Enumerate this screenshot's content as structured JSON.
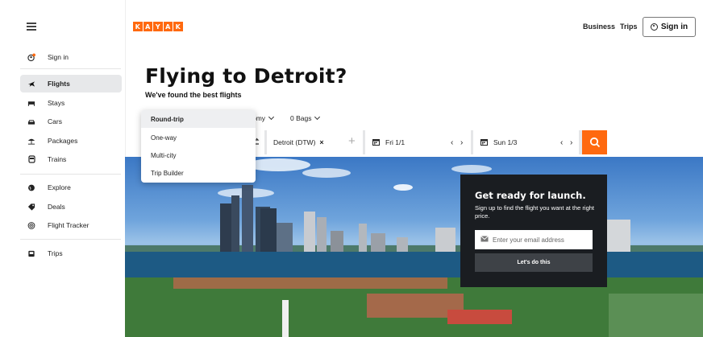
{
  "brand": {
    "logo_letters": [
      "K",
      "A",
      "Y",
      "A",
      "K"
    ],
    "accent": "#ff690f"
  },
  "header": {
    "menu_icon": "hamburger-icon",
    "business": "Business",
    "trips": "Trips",
    "sign_in": "Sign in",
    "user_icon": "user-circle-icon"
  },
  "sidebar": {
    "sign_in": "Sign in",
    "items": [
      {
        "label": "Flights",
        "icon": "plane-icon",
        "active": true
      },
      {
        "label": "Stays",
        "icon": "bed-icon"
      },
      {
        "label": "Cars",
        "icon": "car-icon"
      },
      {
        "label": "Packages",
        "icon": "umbrella-icon"
      },
      {
        "label": "Trains",
        "icon": "train-icon"
      },
      {
        "label": "Explore",
        "icon": "globe-icon"
      },
      {
        "label": "Deals",
        "icon": "tag-icon"
      },
      {
        "label": "Flight Tracker",
        "icon": "radar-icon"
      },
      {
        "label": "Trips",
        "icon": "suitcase-icon"
      }
    ]
  },
  "main": {
    "title": "Flying to Detroit?",
    "subtitle": "We've found the best flights",
    "options": {
      "cabin": "omy",
      "bags": "0 Bags"
    },
    "trip_type_menu": [
      "Round-trip",
      "One-way",
      "Multi-city",
      "Trip Builder"
    ],
    "search": {
      "destination": "Detroit (DTW)",
      "depart": "Fri 1/1",
      "return": "Sun 1/3"
    }
  },
  "promo": {
    "title": "Get ready for launch.",
    "text": "Sign up to find the flight you want at the right price.",
    "email_placeholder": "Enter your email address",
    "button": "Let's do this"
  }
}
